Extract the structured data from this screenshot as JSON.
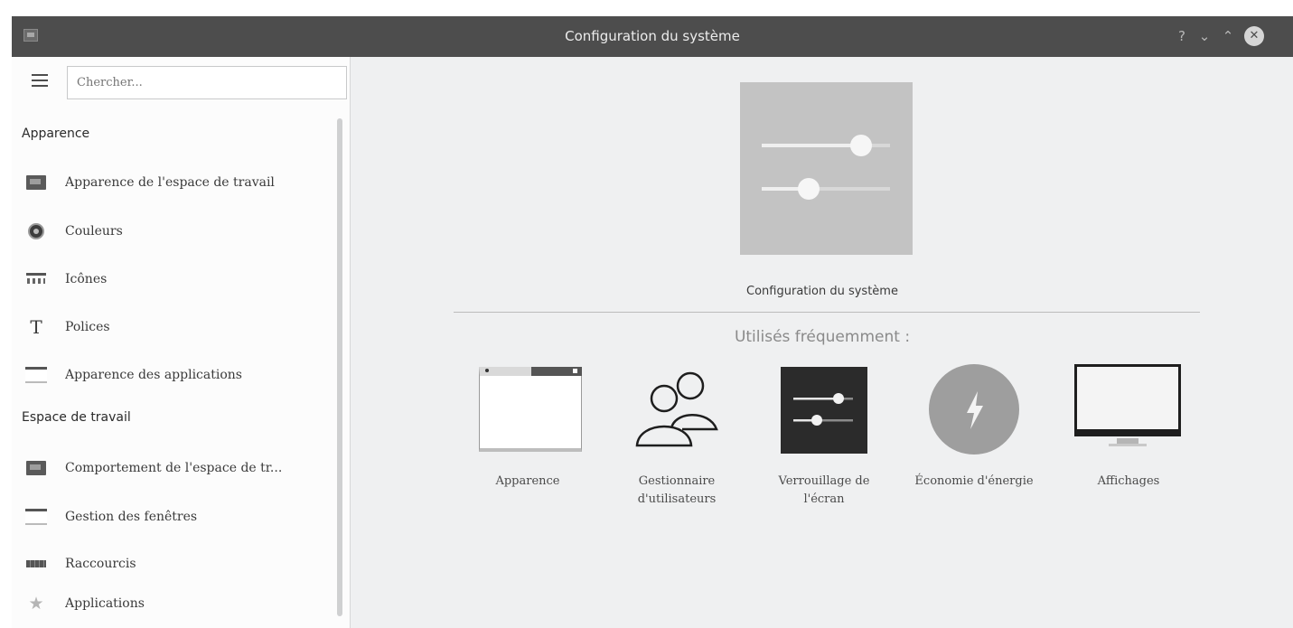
{
  "window": {
    "title": "Configuration du système",
    "controls": {
      "help": "?",
      "minimize": "⌄",
      "maximize": "⌃",
      "close": "✕"
    }
  },
  "search": {
    "placeholder": "Chercher..."
  },
  "sidebar": {
    "sections": [
      {
        "heading": "Apparence",
        "items": [
          {
            "label": "Apparence de l'espace de travail",
            "icon": "desktop-theme-icon"
          },
          {
            "label": "Couleurs",
            "icon": "color-palette-icon"
          },
          {
            "label": "Icônes",
            "icon": "icons-grid-icon"
          },
          {
            "label": "Polices",
            "icon": "font-icon"
          },
          {
            "label": "Apparence des applications",
            "icon": "application-style-icon"
          }
        ]
      },
      {
        "heading": "Espace de travail",
        "items": [
          {
            "label": "Comportement de l'espace de tr...",
            "icon": "workspace-behavior-icon"
          },
          {
            "label": "Gestion des fenêtres",
            "icon": "window-management-icon"
          },
          {
            "label": "Raccourcis",
            "icon": "keyboard-icon"
          },
          {
            "label": "Applications",
            "icon": "star-icon"
          }
        ]
      }
    ]
  },
  "main": {
    "hero_label": "Configuration du système",
    "frequent_heading": "Utilisés fréquemment :",
    "frequent": [
      {
        "label": "Apparence",
        "icon": "appearance-window-icon"
      },
      {
        "label": "Gestionnaire d'utilisateurs",
        "icon": "users-icon"
      },
      {
        "label": "Verrouillage de l'écran",
        "icon": "screen-lock-sliders-icon"
      },
      {
        "label": "Économie d'énergie",
        "icon": "power-saving-icon"
      },
      {
        "label": "Affichages",
        "icon": "monitor-icon"
      }
    ]
  },
  "colors": {
    "titlebar": "#4d4d4d",
    "window_bg": "#eff0f1",
    "sidebar_bg": "#fcfcfc",
    "hero_tile": "#c3c3c3"
  }
}
